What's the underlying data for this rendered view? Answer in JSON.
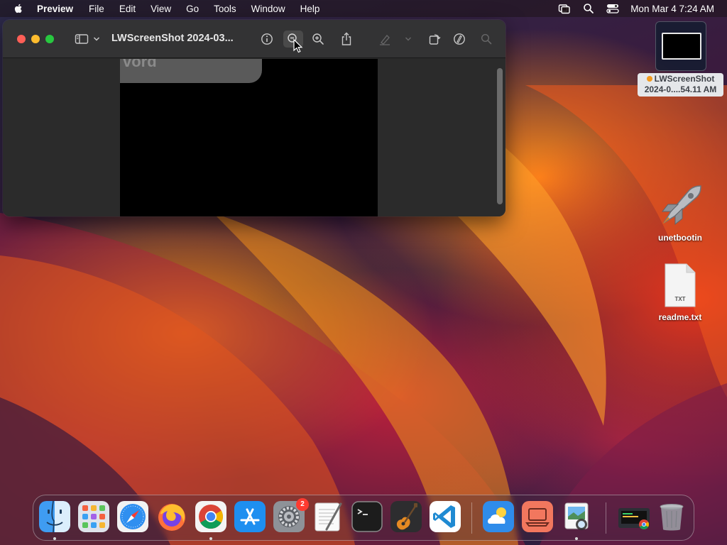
{
  "menubar": {
    "app_name": "Preview",
    "items": [
      "File",
      "Edit",
      "View",
      "Go",
      "Tools",
      "Window",
      "Help"
    ],
    "clock": "Mon Mar 4  7:24 AM",
    "status_icons": [
      "screen-mirroring-icon",
      "spotlight-search-icon",
      "control-center-icon"
    ]
  },
  "window": {
    "title": "LWScreenShot 2024-03...",
    "toolbar_icons": [
      "sidebar-toggle-icon",
      "chevron-down-icon",
      "info-icon",
      "zoom-out-icon",
      "zoom-in-icon",
      "share-icon",
      "highlight-icon",
      "more-icon",
      "rotate-icon",
      "markup-icon",
      "search-icon"
    ],
    "document_fragment_text": "vord"
  },
  "desktop": {
    "screenshot_file_label_line1": "LWScreenShot",
    "screenshot_file_label_line2": "2024-0....54.11 AM",
    "unetbootin_label": "unetbootin",
    "readme_label": "readme.txt",
    "readme_badge": "TXT"
  },
  "dock": {
    "apps": [
      "Finder",
      "Launchpad",
      "Safari",
      "Firefox",
      "Google Chrome",
      "App Store",
      "System Settings",
      "TextEdit",
      "Terminal",
      "GarageBand",
      "Visual Studio Code",
      "Weather",
      "Screen Sharing",
      "Preview",
      "Chrome Apps Folder",
      "Trash"
    ],
    "system_settings_badge": "2"
  },
  "colors": {
    "close": "#ff5f57",
    "minimize": "#febc2e",
    "maximize": "#28c840",
    "badge": "#ff3b30"
  }
}
